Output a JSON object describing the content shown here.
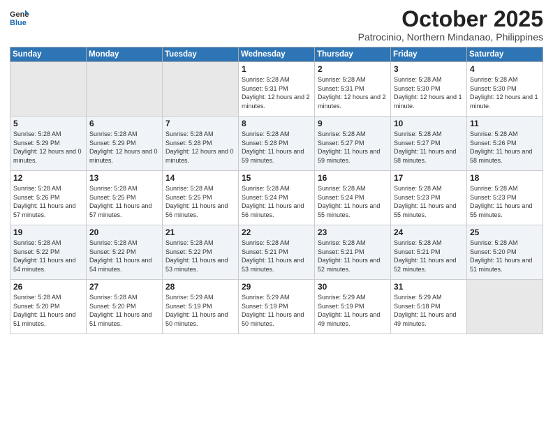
{
  "logo": {
    "general": "General",
    "blue": "Blue"
  },
  "header": {
    "month": "October 2025",
    "location": "Patrocinio, Northern Mindanao, Philippines"
  },
  "days_of_week": [
    "Sunday",
    "Monday",
    "Tuesday",
    "Wednesday",
    "Thursday",
    "Friday",
    "Saturday"
  ],
  "weeks": [
    [
      {
        "day": "",
        "info": ""
      },
      {
        "day": "",
        "info": ""
      },
      {
        "day": "",
        "info": ""
      },
      {
        "day": "1",
        "info": "Sunrise: 5:28 AM\nSunset: 5:31 PM\nDaylight: 12 hours\nand 2 minutes."
      },
      {
        "day": "2",
        "info": "Sunrise: 5:28 AM\nSunset: 5:31 PM\nDaylight: 12 hours\nand 2 minutes."
      },
      {
        "day": "3",
        "info": "Sunrise: 5:28 AM\nSunset: 5:30 PM\nDaylight: 12 hours\nand 1 minute."
      },
      {
        "day": "4",
        "info": "Sunrise: 5:28 AM\nSunset: 5:30 PM\nDaylight: 12 hours\nand 1 minute."
      }
    ],
    [
      {
        "day": "5",
        "info": "Sunrise: 5:28 AM\nSunset: 5:29 PM\nDaylight: 12 hours\nand 0 minutes."
      },
      {
        "day": "6",
        "info": "Sunrise: 5:28 AM\nSunset: 5:29 PM\nDaylight: 12 hours\nand 0 minutes."
      },
      {
        "day": "7",
        "info": "Sunrise: 5:28 AM\nSunset: 5:28 PM\nDaylight: 12 hours\nand 0 minutes."
      },
      {
        "day": "8",
        "info": "Sunrise: 5:28 AM\nSunset: 5:28 PM\nDaylight: 11 hours\nand 59 minutes."
      },
      {
        "day": "9",
        "info": "Sunrise: 5:28 AM\nSunset: 5:27 PM\nDaylight: 11 hours\nand 59 minutes."
      },
      {
        "day": "10",
        "info": "Sunrise: 5:28 AM\nSunset: 5:27 PM\nDaylight: 11 hours\nand 58 minutes."
      },
      {
        "day": "11",
        "info": "Sunrise: 5:28 AM\nSunset: 5:26 PM\nDaylight: 11 hours\nand 58 minutes."
      }
    ],
    [
      {
        "day": "12",
        "info": "Sunrise: 5:28 AM\nSunset: 5:26 PM\nDaylight: 11 hours\nand 57 minutes."
      },
      {
        "day": "13",
        "info": "Sunrise: 5:28 AM\nSunset: 5:25 PM\nDaylight: 11 hours\nand 57 minutes."
      },
      {
        "day": "14",
        "info": "Sunrise: 5:28 AM\nSunset: 5:25 PM\nDaylight: 11 hours\nand 56 minutes."
      },
      {
        "day": "15",
        "info": "Sunrise: 5:28 AM\nSunset: 5:24 PM\nDaylight: 11 hours\nand 56 minutes."
      },
      {
        "day": "16",
        "info": "Sunrise: 5:28 AM\nSunset: 5:24 PM\nDaylight: 11 hours\nand 55 minutes."
      },
      {
        "day": "17",
        "info": "Sunrise: 5:28 AM\nSunset: 5:23 PM\nDaylight: 11 hours\nand 55 minutes."
      },
      {
        "day": "18",
        "info": "Sunrise: 5:28 AM\nSunset: 5:23 PM\nDaylight: 11 hours\nand 55 minutes."
      }
    ],
    [
      {
        "day": "19",
        "info": "Sunrise: 5:28 AM\nSunset: 5:22 PM\nDaylight: 11 hours\nand 54 minutes."
      },
      {
        "day": "20",
        "info": "Sunrise: 5:28 AM\nSunset: 5:22 PM\nDaylight: 11 hours\nand 54 minutes."
      },
      {
        "day": "21",
        "info": "Sunrise: 5:28 AM\nSunset: 5:22 PM\nDaylight: 11 hours\nand 53 minutes."
      },
      {
        "day": "22",
        "info": "Sunrise: 5:28 AM\nSunset: 5:21 PM\nDaylight: 11 hours\nand 53 minutes."
      },
      {
        "day": "23",
        "info": "Sunrise: 5:28 AM\nSunset: 5:21 PM\nDaylight: 11 hours\nand 52 minutes."
      },
      {
        "day": "24",
        "info": "Sunrise: 5:28 AM\nSunset: 5:21 PM\nDaylight: 11 hours\nand 52 minutes."
      },
      {
        "day": "25",
        "info": "Sunrise: 5:28 AM\nSunset: 5:20 PM\nDaylight: 11 hours\nand 51 minutes."
      }
    ],
    [
      {
        "day": "26",
        "info": "Sunrise: 5:28 AM\nSunset: 5:20 PM\nDaylight: 11 hours\nand 51 minutes."
      },
      {
        "day": "27",
        "info": "Sunrise: 5:28 AM\nSunset: 5:20 PM\nDaylight: 11 hours\nand 51 minutes."
      },
      {
        "day": "28",
        "info": "Sunrise: 5:29 AM\nSunset: 5:19 PM\nDaylight: 11 hours\nand 50 minutes."
      },
      {
        "day": "29",
        "info": "Sunrise: 5:29 AM\nSunset: 5:19 PM\nDaylight: 11 hours\nand 50 minutes."
      },
      {
        "day": "30",
        "info": "Sunrise: 5:29 AM\nSunset: 5:19 PM\nDaylight: 11 hours\nand 49 minutes."
      },
      {
        "day": "31",
        "info": "Sunrise: 5:29 AM\nSunset: 5:18 PM\nDaylight: 11 hours\nand 49 minutes."
      },
      {
        "day": "",
        "info": ""
      }
    ]
  ]
}
